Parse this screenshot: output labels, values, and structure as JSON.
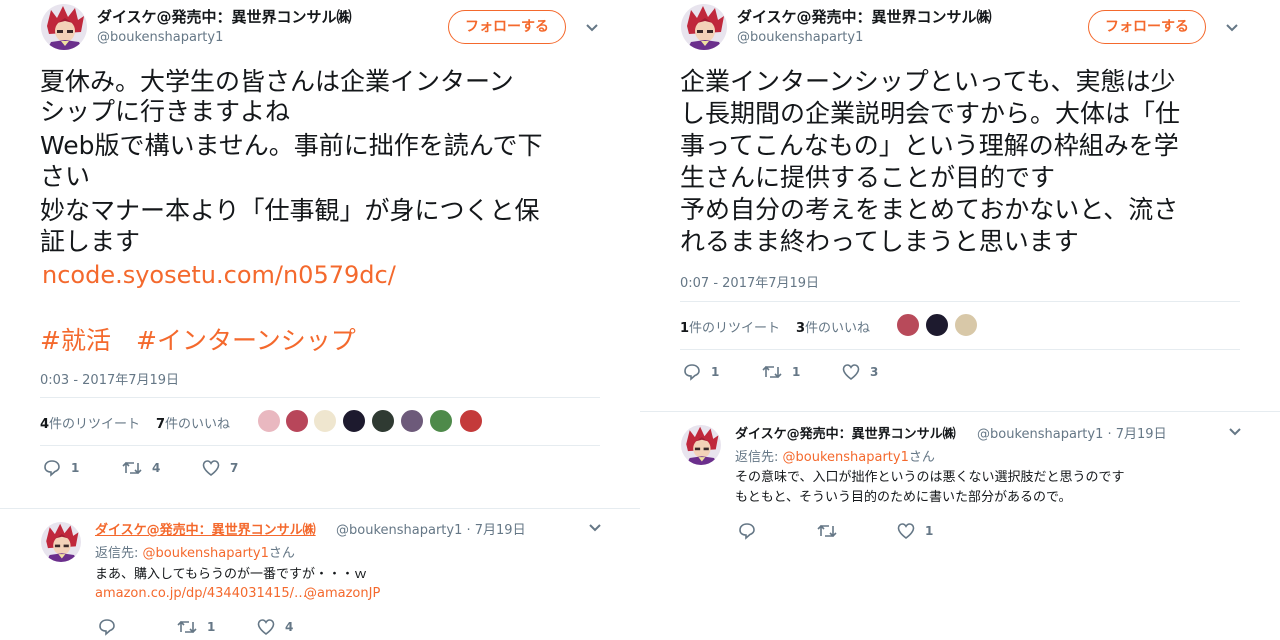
{
  "colors": {
    "accent": "#f4692d",
    "secondary_text": "#657786",
    "divider": "#e6ecf0"
  },
  "icons": {
    "reply": "reply-icon",
    "retweet": "retweet-icon",
    "like": "heart-icon",
    "more": "chevron-down-icon"
  },
  "left": {
    "author": {
      "name": "ダイスケ@発売中：異世界コンサル㈱",
      "handle": "@boukenshaparty1",
      "follow_label": "フォローする"
    },
    "tweet": {
      "lines": [
        "夏休み。大学生の皆さんは企業インターン",
        "シップに行きますよね",
        "Web版で構いません。事前に拙作を読んで下",
        "さい",
        "妙なマナー本より「仕事観」が身につくと保",
        "証します"
      ],
      "link": "ncode.syosetu.com/n0579dc/",
      "hashtags": [
        "#就活",
        "#インターンシップ"
      ],
      "timestamp": "0:03 - 2017年7月19日",
      "retweet_count": "4",
      "retweet_label": "件のリツイート",
      "like_count": "7",
      "like_label": "件のいいね",
      "actions": {
        "reply": "1",
        "retweet": "4",
        "like": "7"
      }
    },
    "reply": {
      "name": "ダイスケ@発売中：異世界コンサル㈱",
      "handle": "@boukenshaparty1",
      "date": "7月19日",
      "reply_to_label": "返信先: ",
      "reply_to_handle": "@boukenshaparty1",
      "reply_to_suffix": "さん",
      "text": "まあ、購入してもらうのが一番ですが・・・ｗ",
      "link": "amazon.co.jp/dp/4344031415/…",
      "mention": "@amazonJP",
      "actions": {
        "reply": "",
        "retweet": "1",
        "like": "4"
      }
    }
  },
  "right": {
    "author": {
      "name": "ダイスケ@発売中：異世界コンサル㈱",
      "handle": "@boukenshaparty1",
      "follow_label": "フォローする"
    },
    "tweet": {
      "lines": [
        "企業インターンシップといっても、実態は少",
        "し長期間の企業説明会ですから。大体は「仕",
        "事ってこんなもの」という理解の枠組みを学",
        "生さんに提供することが目的です",
        "予め自分の考えをまとめておかないと、流さ",
        "れるまま終わってしまうと思います"
      ],
      "timestamp": "0:07 - 2017年7月19日",
      "retweet_count": "1",
      "retweet_label": "件のリツイート",
      "like_count": "3",
      "like_label": "件のいいね",
      "actions": {
        "reply": "1",
        "retweet": "1",
        "like": "3"
      }
    },
    "reply": {
      "name": "ダイスケ@発売中：異世界コンサル㈱",
      "handle": "@boukenshaparty1",
      "date": "7月19日",
      "reply_to_label": "返信先: ",
      "reply_to_handle": "@boukenshaparty1",
      "reply_to_suffix": "さん",
      "text_lines": [
        "その意味で、入口が拙作というのは悪くない選択肢だと思うのです",
        "もともと、そういう目的のために書いた部分があるので。"
      ],
      "actions": {
        "reply": "",
        "retweet": "",
        "like": "1"
      }
    }
  }
}
